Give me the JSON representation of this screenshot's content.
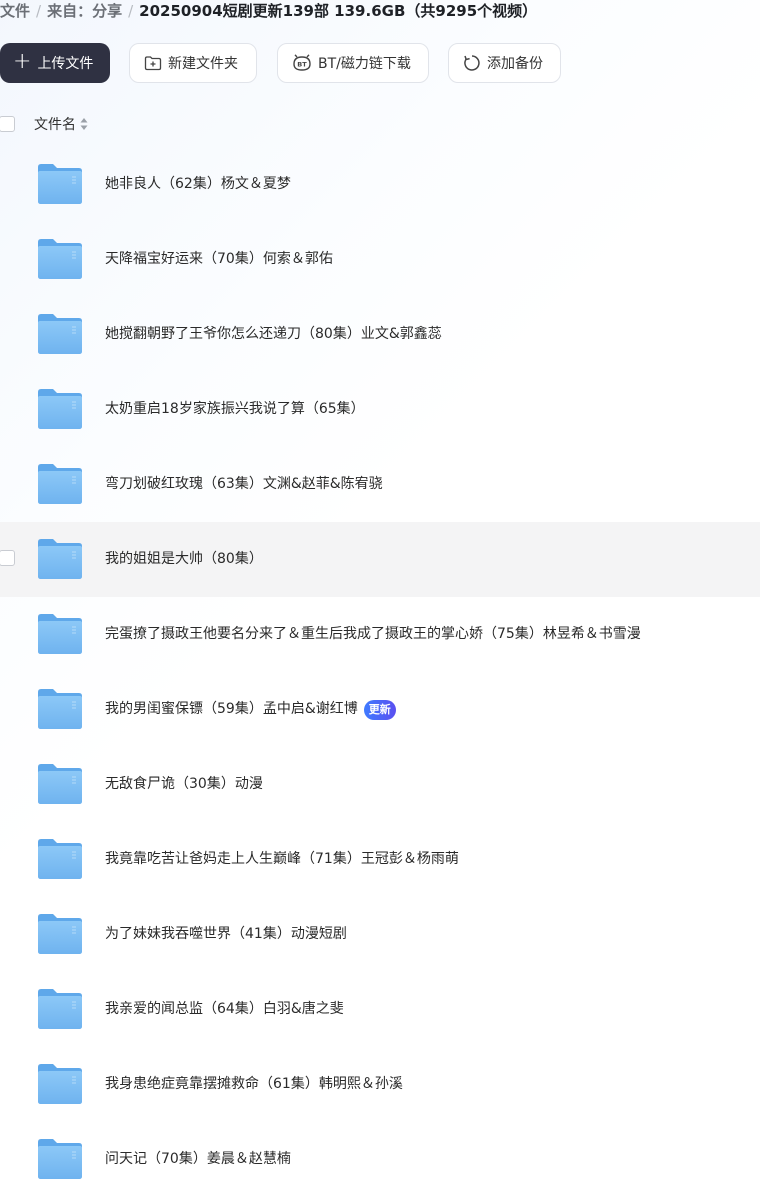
{
  "breadcrumb": {
    "root": "文件",
    "source": "来自：分享",
    "current": "20250904短剧更新139部 139.6GB（共9295个视频）"
  },
  "toolbar": {
    "upload_label": "上传文件",
    "new_folder_label": "新建文件夹",
    "bt_label": "BT/磁力链下载",
    "backup_label": "添加备份"
  },
  "table": {
    "column_name": "文件名"
  },
  "files": [
    {
      "name": "她非良人（62集）杨文＆夏梦"
    },
    {
      "name": "天降福宝好运来（70集）何索＆郭佑"
    },
    {
      "name": "她搅翻朝野了王爷你怎么还递刀（80集）业文&郭鑫蕊"
    },
    {
      "name": "太奶重启18岁家族振兴我说了算（65集）"
    },
    {
      "name": "弯刀划破红玫瑰（63集）文渊&赵菲&陈宥骁"
    },
    {
      "name": "我的姐姐是大帅（80集）"
    },
    {
      "name": "完蛋撩了摄政王他要名分来了＆重生后我成了摄政王的掌心娇（75集）林昱希＆书雪漫"
    },
    {
      "name": "我的男闺蜜保镖（59集）孟中启&谢红博",
      "badge": "更新"
    },
    {
      "name": "无敌食尸诡（30集）动漫"
    },
    {
      "name": "我竟靠吃苦让爸妈走上人生巅峰（71集）王冠彭＆杨雨萌"
    },
    {
      "name": "为了妹妹我吞噬世界（41集）动漫短剧"
    },
    {
      "name": "我亲爱的闻总监（64集）白羽&唐之斐"
    },
    {
      "name": "我身患绝症竟靠摆摊救命（61集）韩明熙＆孙溪"
    },
    {
      "name": "问天记（70集）姜晨＆赵慧楠"
    }
  ],
  "colors": {
    "primary_button": "#2f3142",
    "folder_blue": "#6fb6f2",
    "badge_gradient_start": "#3f7bff",
    "badge_gradient_end": "#5a4ff0",
    "hover_row": "#f4f4f5"
  },
  "icons": {
    "upload": "plus-icon",
    "new_folder": "folder-plus-icon",
    "bt": "bt-magnet-icon",
    "backup": "refresh-icon",
    "sort": "sort-icon",
    "folder": "folder-icon"
  }
}
